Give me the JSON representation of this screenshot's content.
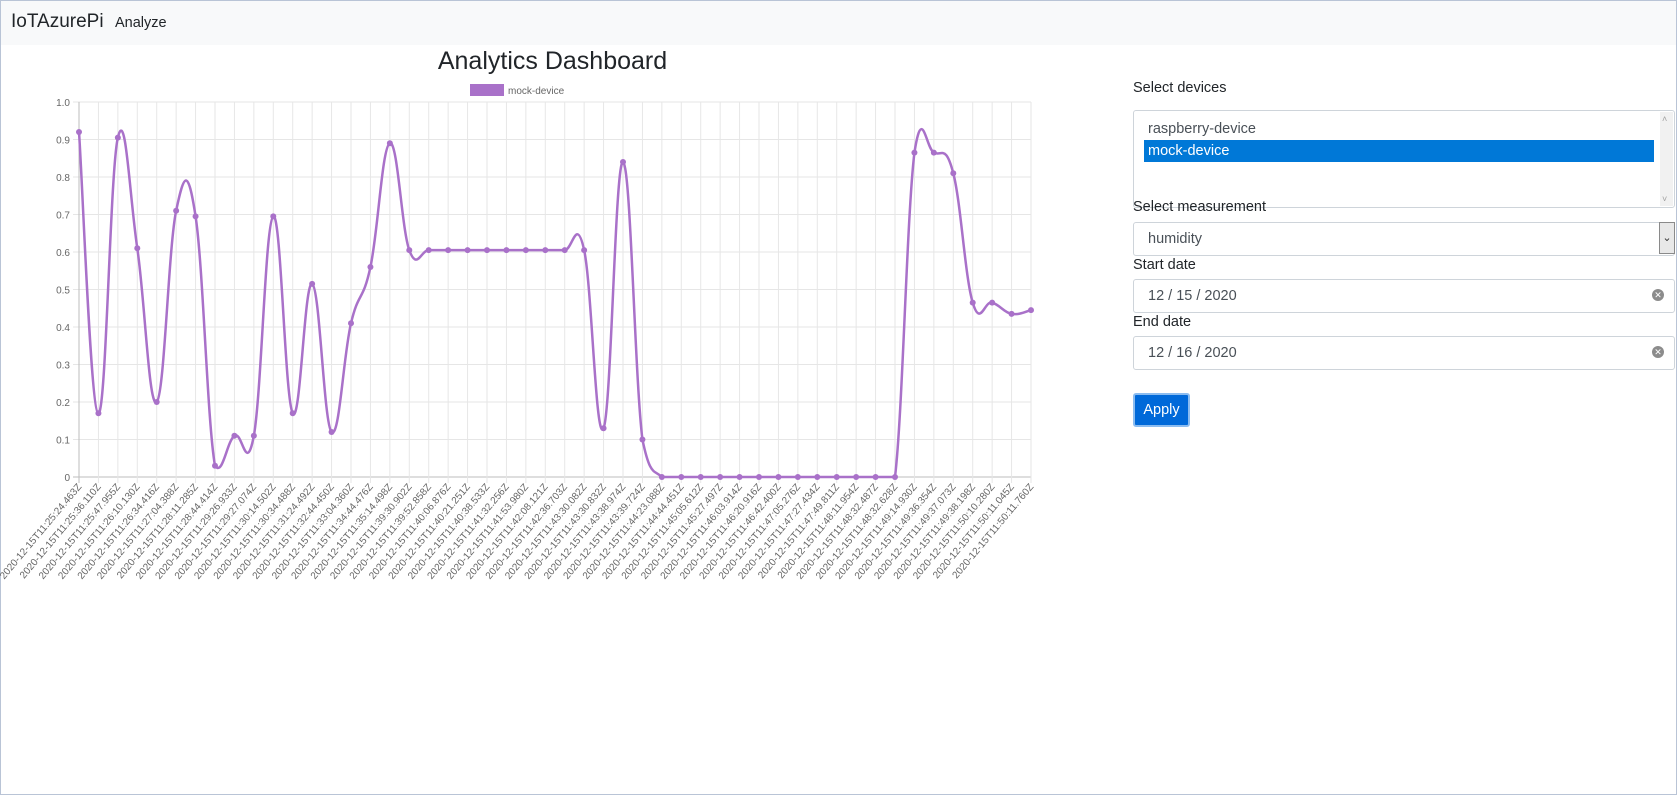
{
  "navbar": {
    "brand": "IoTAzurePi",
    "links": [
      "Analyze"
    ]
  },
  "dashboard": {
    "title": "Analytics Dashboard"
  },
  "form": {
    "devices_label": "Select devices",
    "devices": [
      {
        "label": "raspberry-device",
        "selected": false
      },
      {
        "label": "mock-device",
        "selected": true
      }
    ],
    "measurement_label": "Select measurement",
    "measurement_value": "humidity",
    "start_label": "Start date",
    "start_value": "12 / 15 / 2020",
    "end_label": "End date",
    "end_value": "12 / 16 / 2020",
    "apply_label": "Apply"
  },
  "chart_data": {
    "type": "line",
    "title": "",
    "legend": "top-center",
    "grid": true,
    "ylim": [
      0,
      1
    ],
    "yticks": [
      "1.0",
      "0.9",
      "0.8",
      "0.7",
      "0.6",
      "0.5",
      "0.4",
      "0.3",
      "0.2",
      "0.1",
      "0"
    ],
    "color": "#a971c9",
    "x": [
      "2020-12-15T11:25:24.463Z",
      "2020-12-15T11:25:36.110Z",
      "2020-12-15T11:25:47.955Z",
      "2020-12-15T11:26:10.130Z",
      "2020-12-15T11:26:34.416Z",
      "2020-12-15T11:27:04.388Z",
      "2020-12-15T11:28:11.285Z",
      "2020-12-15T11:28:44.414Z",
      "2020-12-15T11:29:26.933Z",
      "2020-12-15T11:29:27.074Z",
      "2020-12-15T11:30:14.502Z",
      "2020-12-15T11:30:34.488Z",
      "2020-12-15T11:31:24.492Z",
      "2020-12-15T11:32:44.450Z",
      "2020-12-15T11:33:04.360Z",
      "2020-12-15T11:34:44.476Z",
      "2020-12-15T11:35:14.498Z",
      "2020-12-15T11:39:30.902Z",
      "2020-12-15T11:39:52.858Z",
      "2020-12-15T11:40:06.876Z",
      "2020-12-15T11:40:21.251Z",
      "2020-12-15T11:40:38.533Z",
      "2020-12-15T11:41:32.256Z",
      "2020-12-15T11:41:53.980Z",
      "2020-12-15T11:42:08.121Z",
      "2020-12-15T11:42:36.703Z",
      "2020-12-15T11:43:30.082Z",
      "2020-12-15T11:43:30.832Z",
      "2020-12-15T11:43:38.974Z",
      "2020-12-15T11:43:39.724Z",
      "2020-12-15T11:44:23.088Z",
      "2020-12-15T11:44:44.451Z",
      "2020-12-15T11:45:05.612Z",
      "2020-12-15T11:45:27.497Z",
      "2020-12-15T11:46:03.914Z",
      "2020-12-15T11:46:20.916Z",
      "2020-12-15T11:46:42.400Z",
      "2020-12-15T11:47:05.276Z",
      "2020-12-15T11:47:27.434Z",
      "2020-12-15T11:47:49.811Z",
      "2020-12-15T11:48:11.954Z",
      "2020-12-15T11:48:32.487Z",
      "2020-12-15T11:48:32.628Z",
      "2020-12-15T11:49:14.930Z",
      "2020-12-15T11:49:36.354Z",
      "2020-12-15T11:49:37.073Z",
      "2020-12-15T11:49:38.198Z",
      "2020-12-15T11:50:10.280Z",
      "2020-12-15T11:50:11.045Z",
      "2020-12-15T11:50:11.760Z"
    ],
    "series": [
      {
        "name": "mock-device",
        "values": [
          0.92,
          0.17,
          0.905,
          0.61,
          0.2,
          0.71,
          0.695,
          0.03,
          0.11,
          0.11,
          0.695,
          0.17,
          0.515,
          0.12,
          0.41,
          0.56,
          0.89,
          0.605,
          0.605,
          0.605,
          0.605,
          0.605,
          0.605,
          0.605,
          0.605,
          0.605,
          0.605,
          0.13,
          0.84,
          0.1,
          0,
          0,
          0,
          0,
          0,
          0,
          0,
          0,
          0,
          0,
          0,
          0,
          0,
          0.865,
          0.865,
          0.81,
          0.465,
          0.465,
          0.435,
          0.445
        ]
      }
    ]
  }
}
